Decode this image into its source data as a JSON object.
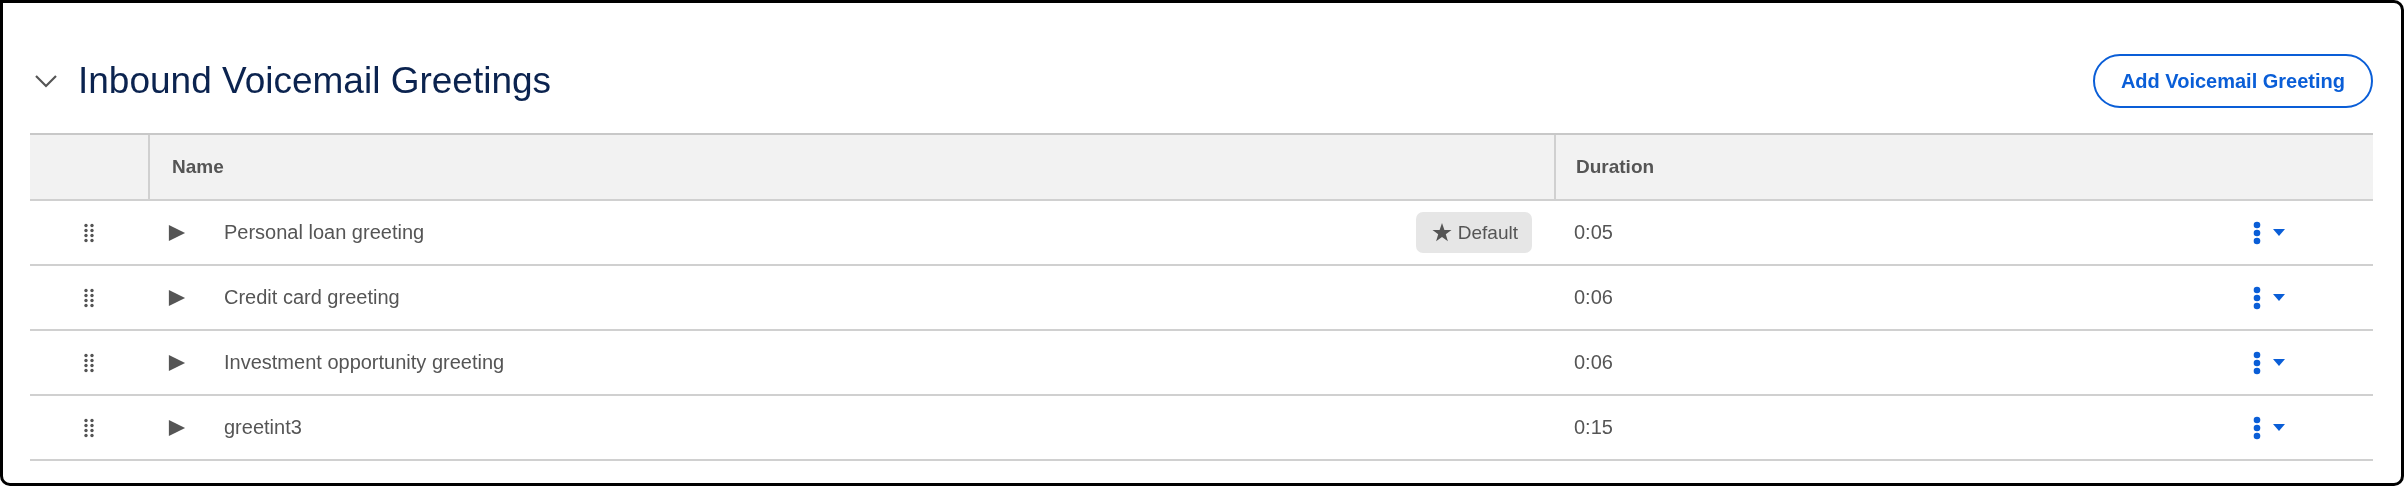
{
  "section": {
    "title": "Inbound Voicemail Greetings",
    "expanded": true,
    "add_button": "Add Voicemail Greeting"
  },
  "table": {
    "columns": [
      "Name",
      "Duration"
    ],
    "rows": [
      {
        "name": "Personal loan greeting",
        "badge": "Default",
        "duration": "0:05"
      },
      {
        "name": "Credit card greeting",
        "duration": "0:06"
      },
      {
        "name": "Investment opportunity greeting",
        "duration": "0:06"
      },
      {
        "name": "greetint3",
        "duration": "0:15"
      }
    ]
  }
}
